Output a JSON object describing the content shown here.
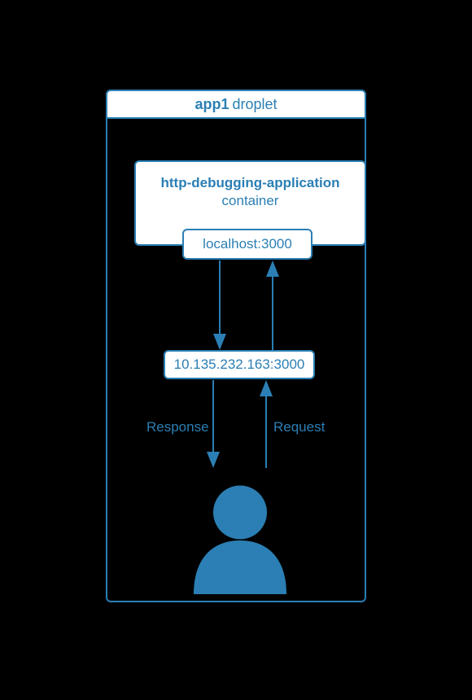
{
  "droplet": {
    "name": "app1",
    "label": "droplet"
  },
  "container": {
    "title": "http-debugging-application",
    "subtitle": "container",
    "port_label": "localhost:3000"
  },
  "network": {
    "ip_port": "10.135.232.163:3000"
  },
  "flow": {
    "response_label": "Response",
    "request_label": "Request"
  },
  "colors": {
    "stroke": "#2b7fb4",
    "fill": "#2b7fb4",
    "bg": "#000000",
    "box_bg": "#ffffff"
  }
}
